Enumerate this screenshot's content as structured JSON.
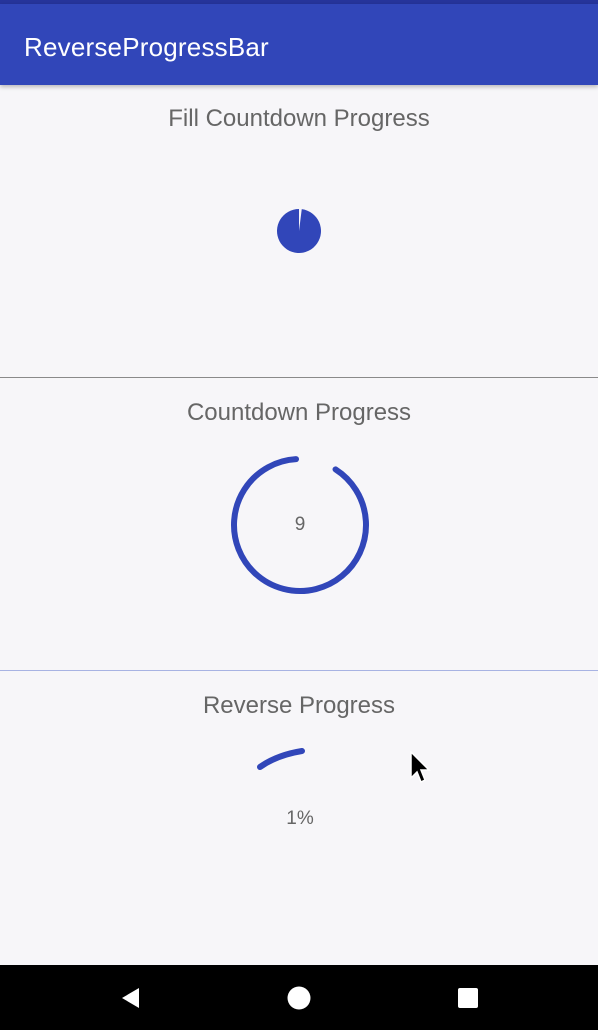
{
  "app_bar": {
    "title": "ReverseProgressBar"
  },
  "sections": [
    {
      "title": "Fill Countdown Progress",
      "progress": 0.02
    },
    {
      "title": "Countdown Progress",
      "count": "9",
      "progress": 0.9
    },
    {
      "title": "Reverse Progress",
      "percent": "1%"
    }
  ],
  "colors": {
    "accent": "#3146b9",
    "app_bar": "#3146b9",
    "text": "#666666"
  },
  "nav": {
    "back_icon": "back-icon",
    "home_icon": "home-icon",
    "recents_icon": "recents-icon"
  }
}
